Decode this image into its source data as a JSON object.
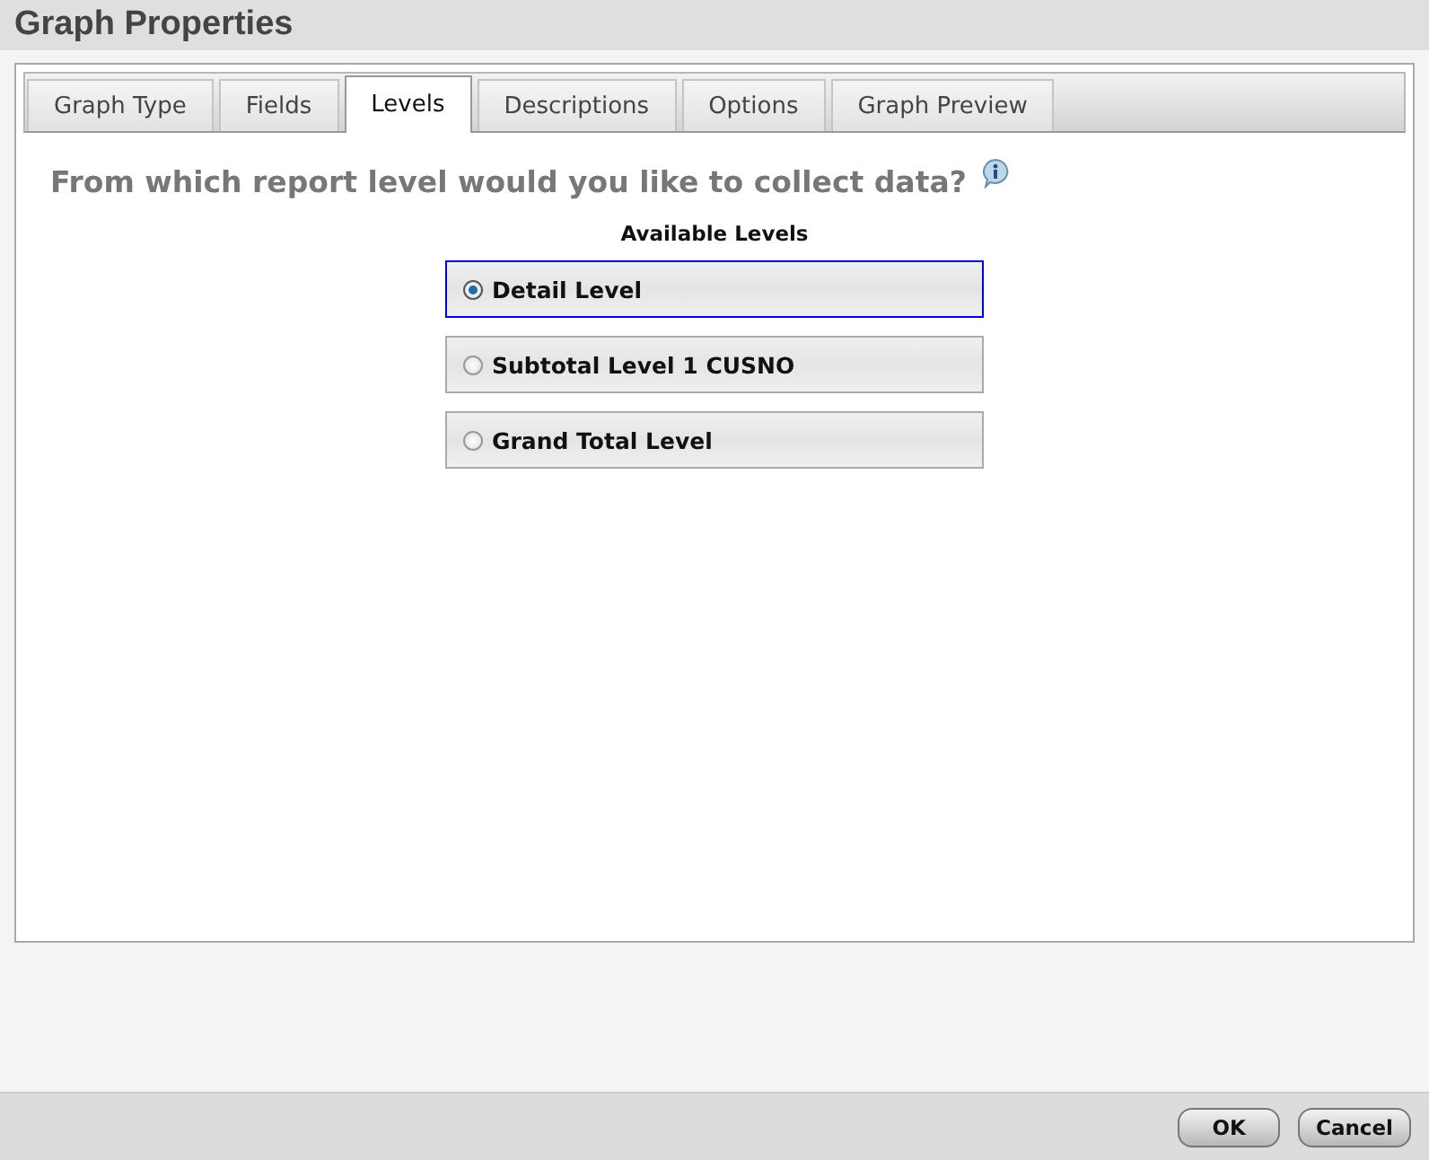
{
  "window": {
    "title": "Graph Properties"
  },
  "tabs": [
    {
      "label": "Graph Type",
      "selected": false
    },
    {
      "label": "Fields",
      "selected": false
    },
    {
      "label": "Levels",
      "selected": true
    },
    {
      "label": "Descriptions",
      "selected": false
    },
    {
      "label": "Options",
      "selected": false
    },
    {
      "label": "Graph Preview",
      "selected": false
    }
  ],
  "question": "From which report level would you like to collect data?",
  "levels_heading": "Available Levels",
  "levels": [
    {
      "label": "Detail Level",
      "selected": true
    },
    {
      "label": "Subtotal Level 1 CUSNO",
      "selected": false
    },
    {
      "label": "Grand Total Level",
      "selected": false
    }
  ],
  "buttons": [
    "OK",
    "Cancel"
  ]
}
